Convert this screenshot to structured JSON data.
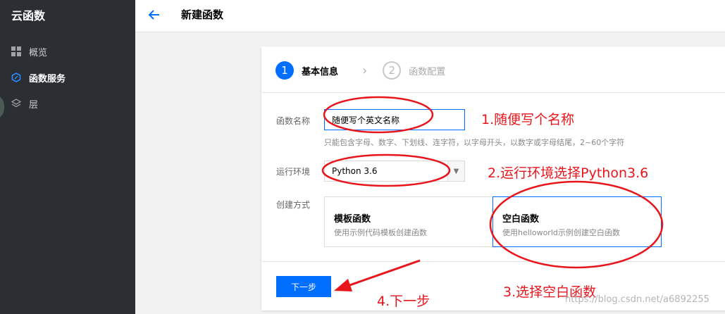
{
  "sidebar": {
    "title": "云函数",
    "items": [
      {
        "label": "概览",
        "icon": "grid-icon"
      },
      {
        "label": "函数服务",
        "icon": "hexagon-icon"
      },
      {
        "label": "层",
        "icon": "layers-icon"
      }
    ]
  },
  "header": {
    "title": "新建函数",
    "back_icon": "arrow-left-icon"
  },
  "steps": [
    {
      "number": "1",
      "label": "基本信息"
    },
    {
      "number": "2",
      "label": "函数配置"
    }
  ],
  "form": {
    "name_label": "函数名称",
    "name_value": "随便写个英文名称",
    "name_hint": "只能包含字母、数字、下划线、连字符，以字母开头，以数字或字母结尾，2~60个字符",
    "runtime_label": "运行环境",
    "runtime_value": "Python 3.6",
    "method_label": "创建方式",
    "methods": [
      {
        "title": "模板函数",
        "desc": "使用示例代码模板创建函数"
      },
      {
        "title": "空白函数",
        "desc": "使用helloworld示例创建空白函数"
      }
    ],
    "selected_method": "空白函数",
    "next_label": "下一步"
  },
  "annotations": {
    "step1": "1.随便写个名称",
    "step2": "2.运行环境选择Python3.6",
    "step3": "3.选择空白函数",
    "step4": "4.下一步",
    "color": "#e8161c"
  },
  "watermark": "https://blog.csdn.net/a6892255",
  "colors": {
    "accent": "#006eff",
    "sidebar": "#2b2e33"
  }
}
